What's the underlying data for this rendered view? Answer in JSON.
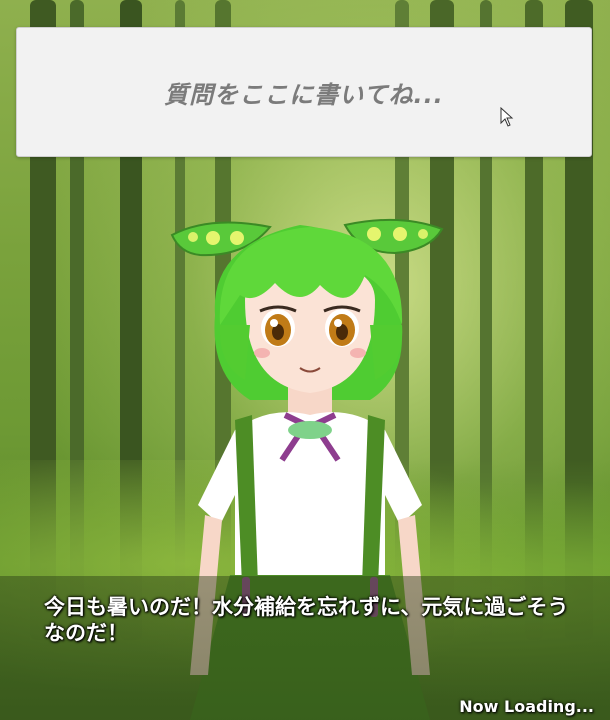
{
  "question_input": {
    "placeholder": "質問をここに書いてね..."
  },
  "dialog": {
    "message": "今日も暑いのだ！水分補給を忘れずに、元気に過ごそうなのだ！"
  },
  "status": {
    "loading_text": "Now Loading..."
  },
  "character": {
    "name": "",
    "icon": "anime-character-avatar"
  },
  "colors": {
    "hair": "#5fd83a",
    "dress": "#4d8d25",
    "ribbon": "#8e3d8f",
    "input_bg": "#f2f2f2",
    "placeholder": "#7b7b7b"
  }
}
